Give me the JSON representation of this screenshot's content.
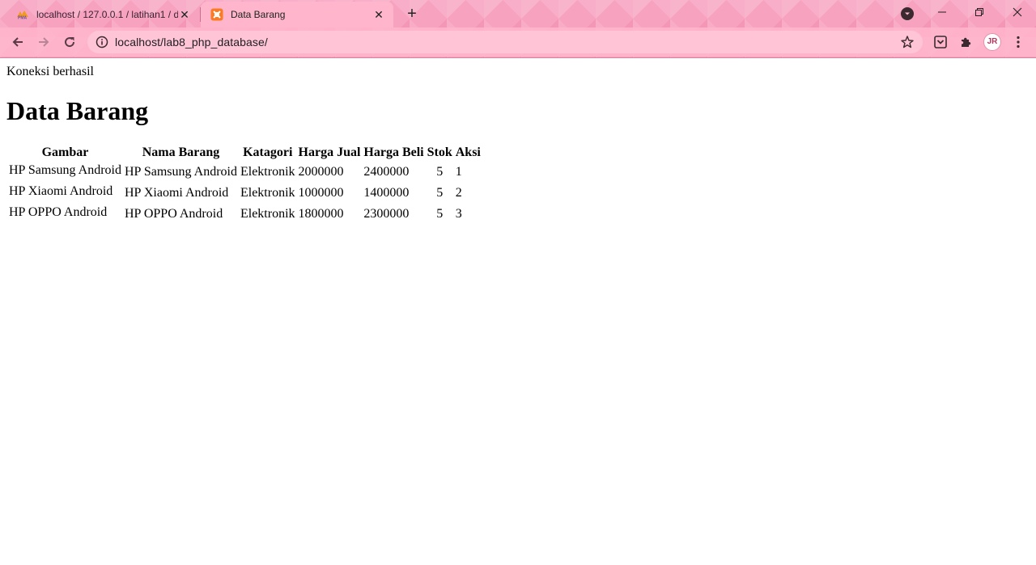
{
  "browser": {
    "tabs": [
      {
        "title": "localhost / 127.0.0.1 / latihan1 / d",
        "favicon": "phpmyadmin-icon",
        "active": false
      },
      {
        "title": "Data Barang",
        "favicon": "xampp-icon",
        "active": true
      }
    ],
    "address": "localhost/lab8_php_database/",
    "avatar_initials": "JR"
  },
  "page": {
    "status_text": "Koneksi berhasil",
    "heading": "Data Barang",
    "table": {
      "headers": [
        "Gambar",
        "Nama Barang",
        "Katagori",
        "Harga Jual",
        "Harga Beli",
        "Stok",
        "Aksi"
      ],
      "rows": [
        {
          "gambar_alt": "HP Samsung Android",
          "nama": "HP Samsung Android",
          "kategori": "Elektronik",
          "harga_jual": "2000000",
          "harga_beli": "2400000",
          "stok": "5",
          "aksi": "1"
        },
        {
          "gambar_alt": "HP Xiaomi Android",
          "nama": "HP Xiaomi Android",
          "kategori": "Elektronik",
          "harga_jual": "1000000",
          "harga_beli": "1400000",
          "stok": "5",
          "aksi": "2"
        },
        {
          "gambar_alt": "HP OPPO Android",
          "nama": "HP OPPO Android",
          "kategori": "Elektronik",
          "harga_jual": "1800000",
          "harga_beli": "2300000",
          "stok": "5",
          "aksi": "3"
        }
      ]
    }
  },
  "colors": {
    "chrome_pink": "#f7a3c0",
    "active_tab": "#ffb6cc",
    "omnibox": "#ffc4d6"
  }
}
